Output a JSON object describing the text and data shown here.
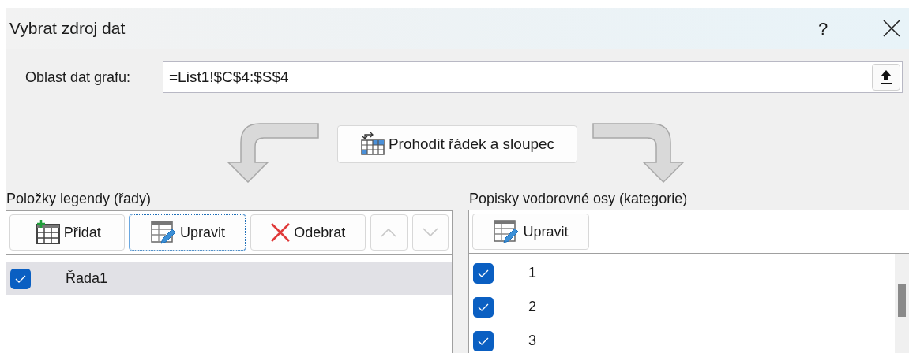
{
  "window": {
    "title": "Vybrat zdroj dat",
    "help": "?"
  },
  "data_range": {
    "label": "Oblast dat grafu:",
    "value": "=List1!$C$4:$S$4"
  },
  "switch_button": {
    "label": "Prohodit řádek a sloupec"
  },
  "legend": {
    "label": "Položky legendy (řady)",
    "toolbar": [
      {
        "kind": "add",
        "label": "Přidat",
        "focused": false,
        "disabled": false
      },
      {
        "kind": "edit",
        "label": "Upravit",
        "focused": true,
        "disabled": false
      },
      {
        "kind": "remove",
        "label": "Odebrat",
        "focused": false,
        "disabled": false
      },
      {
        "kind": "up",
        "focused": false,
        "disabled": true
      },
      {
        "kind": "down",
        "focused": false,
        "disabled": true
      }
    ],
    "items": [
      {
        "label": "Řada1",
        "checked": true,
        "selected": true
      }
    ]
  },
  "axis": {
    "label": "Popisky vodorovné osy (kategorie)",
    "toolbar": [
      {
        "kind": "edit",
        "label": "Upravit",
        "focused": false,
        "disabled": false
      }
    ],
    "items": [
      {
        "label": "1",
        "checked": true,
        "selected": false
      },
      {
        "label": "2",
        "checked": true,
        "selected": false
      },
      {
        "label": "3",
        "checked": true,
        "selected": false
      }
    ]
  }
}
